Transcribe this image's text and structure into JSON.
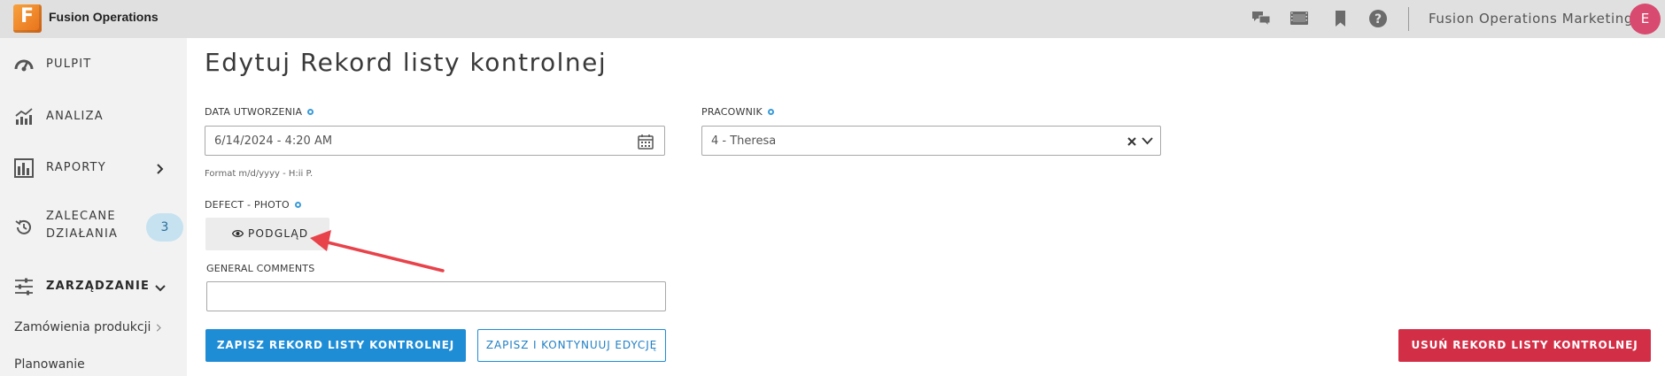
{
  "topbar": {
    "logo_letter": "F",
    "app_name": "Fusion Operations",
    "company": "Fusion Operations Marketing",
    "avatar_initial": "E",
    "icons": [
      "chat-icon",
      "film-icon",
      "bookmark-icon",
      "help-icon"
    ]
  },
  "sidebar": {
    "items": [
      {
        "label": "PULPIT",
        "icon": "dashboard-gauge-icon"
      },
      {
        "label": "ANALIZA",
        "icon": "analytics-chart-icon"
      },
      {
        "label": "RAPORTY",
        "icon": "reports-bar-icon"
      },
      {
        "label_line1": "ZALECANE",
        "label_line2": "DZIAŁANIA",
        "icon": "history-icon",
        "badge": "3"
      },
      {
        "label": "ZARZĄDZANIE",
        "icon": "sliders-icon"
      }
    ],
    "sub_items": [
      {
        "label": "Zamówienia produkcji"
      },
      {
        "label": "Planowanie"
      }
    ]
  },
  "main": {
    "title": "Edytuj Rekord listy kontrolnej",
    "fields": {
      "created": {
        "label": "DATA UTWORZENIA",
        "value": "6/14/2024 - 4:20 AM",
        "hint": "Format m/d/yyyy - H:ii P."
      },
      "employee": {
        "label": "PRACOWNIK",
        "value": "4 - Theresa"
      },
      "photo": {
        "label": "DEFECT - PHOTO",
        "button_label": "PODGLĄD"
      },
      "comments": {
        "label": "GENERAL COMMENTS",
        "value": ""
      }
    },
    "buttons": {
      "save": "ZAPISZ REKORD LISTY KONTROLNEJ",
      "save_continue": "ZAPISZ I KONTYNUUJ EDYCJĘ",
      "delete": "USUŃ REKORD LISTY KONTROLNEJ"
    }
  },
  "colors": {
    "topbar_bg": "#e0e0e0",
    "sidebar_bg": "#f2f2f2",
    "primary": "#1f8dd6",
    "danger": "#d22f47",
    "annotation_arrow": "#e8424a",
    "logo_orange": "#f08a2a"
  }
}
